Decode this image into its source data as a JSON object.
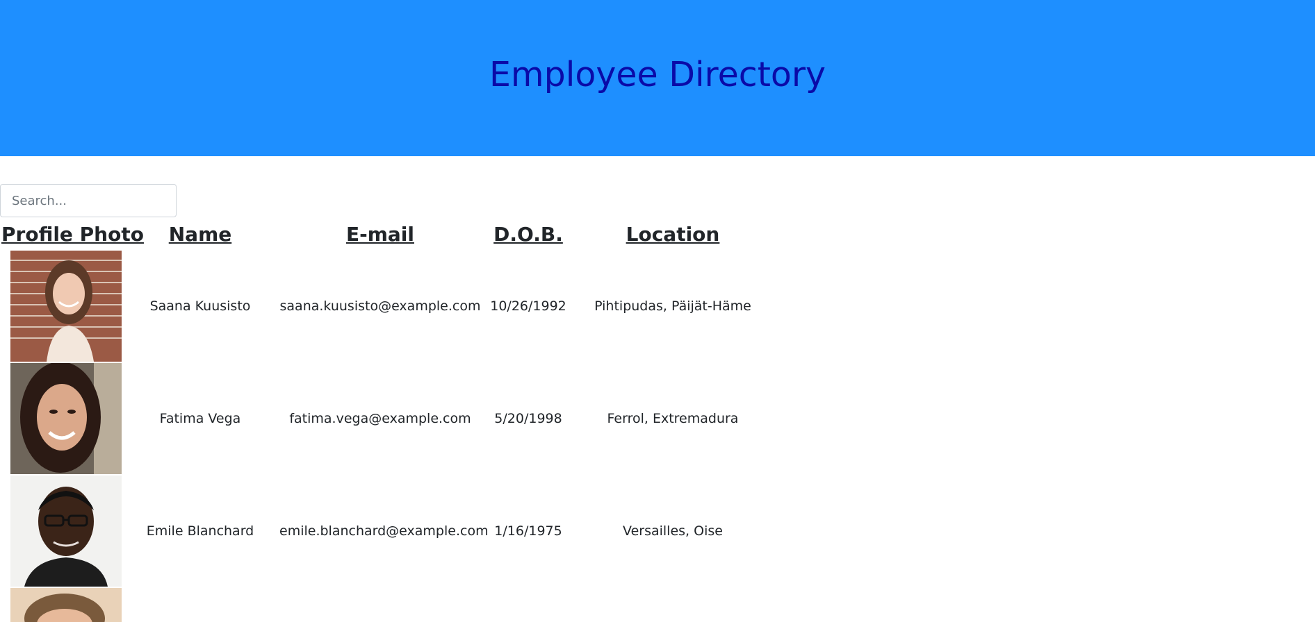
{
  "header": {
    "title": "Employee Directory"
  },
  "search": {
    "placeholder": "Search..."
  },
  "table": {
    "columns": [
      "Profile Photo",
      "Name",
      "E-mail",
      "D.O.B.",
      "Location"
    ],
    "rows": [
      {
        "name": "Saana Kuusisto",
        "email": "saana.kuusisto@example.com",
        "dob": "10/26/1992",
        "location": "Pihtipudas, Päijät-Häme"
      },
      {
        "name": "Fatima Vega",
        "email": "fatima.vega@example.com",
        "dob": "5/20/1998",
        "location": "Ferrol, Extremadura"
      },
      {
        "name": "Emile Blanchard",
        "email": "emile.blanchard@example.com",
        "dob": "1/16/1975",
        "location": "Versailles, Oise"
      }
    ]
  },
  "colors": {
    "header_bg": "#1e8fff",
    "title": "#0a0aa8"
  }
}
